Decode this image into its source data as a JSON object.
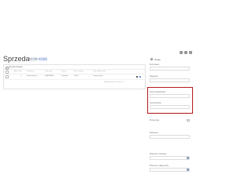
{
  "header": {
    "title": "Sprzedaze",
    "badges": [
      "Ext. rollback",
      "W magazynie"
    ],
    "top_icons": [
      "bell-icon",
      "grid-icon",
      "user-icon"
    ]
  },
  "table": {
    "card_title": "Sposób dostaw",
    "columns": [
      "Akcesoria",
      "Kategoria",
      "Kod mag.",
      "Grupa",
      "Ilość zamów",
      "Dane właściciela"
    ],
    "rows": [
      {
        "id": "1",
        "name": "Lorem ipsum",
        "code": "000000000",
        "group": "Dowolne",
        "qty": "13:19",
        "owner": "Lorem ipsum"
      }
    ],
    "footer": "Pokaż wiersze: 10   1-1 z 1"
  },
  "panel": {
    "title": "Opcje",
    "fields": [
      {
        "label": "Kod towaru"
      },
      {
        "label": "Kategoria"
      },
      {
        "label": "Ilość produktów/ha"
      },
      {
        "label": "Cena bazowa"
      },
      {
        "label": "Preferencje"
      },
      {
        "label": "Dostawca"
      },
      {
        "label": "Wolumen minimalny"
      },
      {
        "label": "Wolumen maksymalny"
      }
    ],
    "highlight_color": "#b71c1c"
  }
}
